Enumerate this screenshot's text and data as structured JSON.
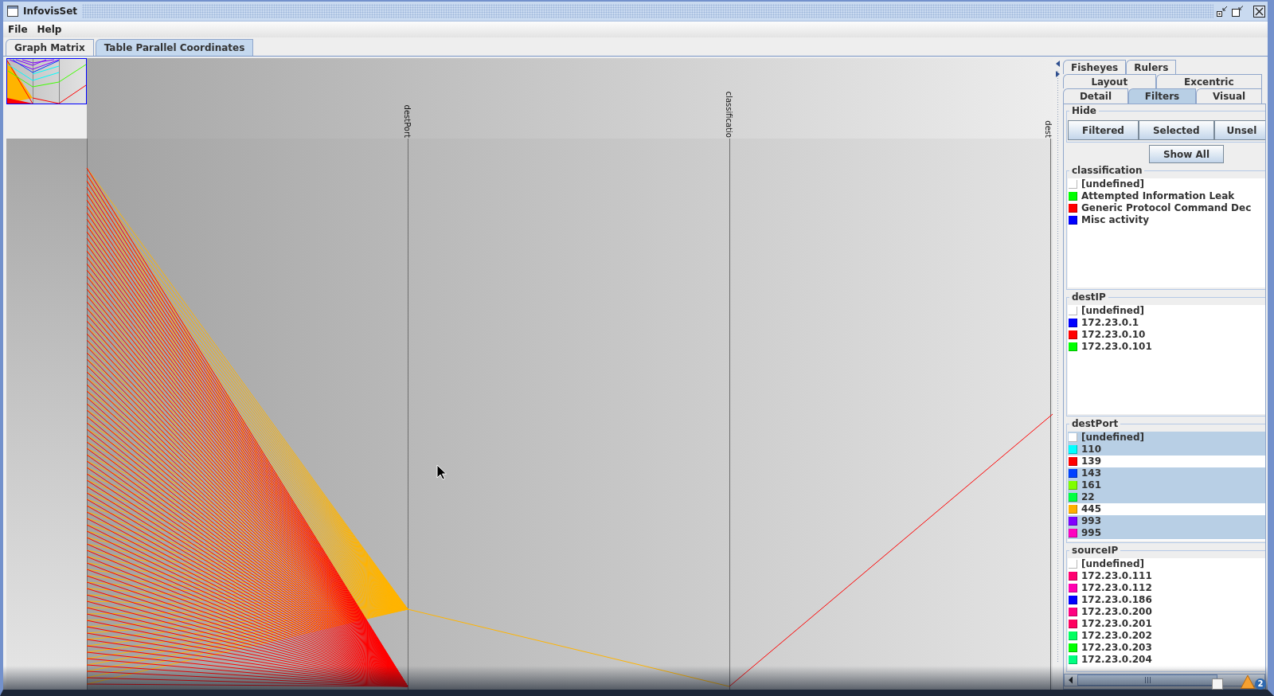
{
  "window": {
    "title": "InfovisSet"
  },
  "menu": [
    "File",
    "Help"
  ],
  "tabs": [
    {
      "label": "Graph Matrix",
      "selected": false
    },
    {
      "label": "Table Parallel Coordinates",
      "selected": true
    }
  ],
  "parallel_coordinates": {
    "axes": [
      {
        "kind": "covered"
      },
      {
        "kind": "named",
        "label": "destPort"
      },
      {
        "kind": "named",
        "label": "classificatio"
      },
      {
        "kind": "named",
        "label": "dest"
      }
    ]
  },
  "side_tabs": {
    "rows": [
      {
        "tabs": [
          {
            "label": "Fisheyes",
            "selected": false
          },
          {
            "label": "Rulers",
            "selected": false
          }
        ]
      },
      {
        "tabs": [
          {
            "label": "Layout",
            "selected": false
          },
          {
            "label": "Excentric",
            "selected": false
          }
        ]
      },
      {
        "tabs": [
          {
            "label": "Detail",
            "selected": false
          },
          {
            "label": "Filters",
            "selected": true
          },
          {
            "label": "Visual",
            "selected": false
          }
        ]
      }
    ]
  },
  "filters": {
    "hide": {
      "title": "Hide",
      "buttons": [
        "Filtered",
        "Selected",
        "Unsel"
      ]
    },
    "show_all": "Show All",
    "groups": [
      {
        "title": "classification",
        "items": [
          {
            "label": "[undefined]",
            "color": "#ffffff",
            "selected": false
          },
          {
            "label": "Attempted Information Leak",
            "color": "#00ff00",
            "selected": false
          },
          {
            "label": "Generic Protocol Command Dec",
            "color": "#ff0000",
            "selected": false
          },
          {
            "label": "Misc activity",
            "color": "#0000ff",
            "selected": false
          }
        ]
      },
      {
        "title": "destIP",
        "items": [
          {
            "label": "[undefined]",
            "color": "#ffffff",
            "selected": false
          },
          {
            "label": "172.23.0.1",
            "color": "#0000ff",
            "selected": false
          },
          {
            "label": "172.23.0.10",
            "color": "#ff0000",
            "selected": false
          },
          {
            "label": "172.23.0.101",
            "color": "#00ff00",
            "selected": false
          }
        ]
      },
      {
        "title": "destPort",
        "items": [
          {
            "label": "[undefined]",
            "color": "#ffffff",
            "selected": true
          },
          {
            "label": "110",
            "color": "#00ffff",
            "selected": true
          },
          {
            "label": "139",
            "color": "#ff0000",
            "selected": false
          },
          {
            "label": "143",
            "color": "#0040ff",
            "selected": true
          },
          {
            "label": "161",
            "color": "#80ff00",
            "selected": true
          },
          {
            "label": "22",
            "color": "#00ff40",
            "selected": true
          },
          {
            "label": "445",
            "color": "#ffb000",
            "selected": false
          },
          {
            "label": "993",
            "color": "#8000ff",
            "selected": true
          },
          {
            "label": "995",
            "color": "#ff00c0",
            "selected": true
          }
        ]
      },
      {
        "title": "sourceIP",
        "items": [
          {
            "label": "[undefined]",
            "color": "#ffffff",
            "selected": false
          },
          {
            "label": "172.23.0.111",
            "color": "#ff0070",
            "selected": false
          },
          {
            "label": "172.23.0.112",
            "color": "#ff00b0",
            "selected": false
          },
          {
            "label": "172.23.0.186",
            "color": "#0000ff",
            "selected": false
          },
          {
            "label": "172.23.0.200",
            "color": "#ff0080",
            "selected": false
          },
          {
            "label": "172.23.0.201",
            "color": "#ff0060",
            "selected": false
          },
          {
            "label": "172.23.0.202",
            "color": "#00ff60",
            "selected": false
          },
          {
            "label": "172.23.0.203",
            "color": "#00ff00",
            "selected": false
          },
          {
            "label": "172.23.0.204",
            "color": "#00ff80",
            "selected": false
          }
        ]
      }
    ]
  },
  "notification": {
    "badge": "2"
  }
}
